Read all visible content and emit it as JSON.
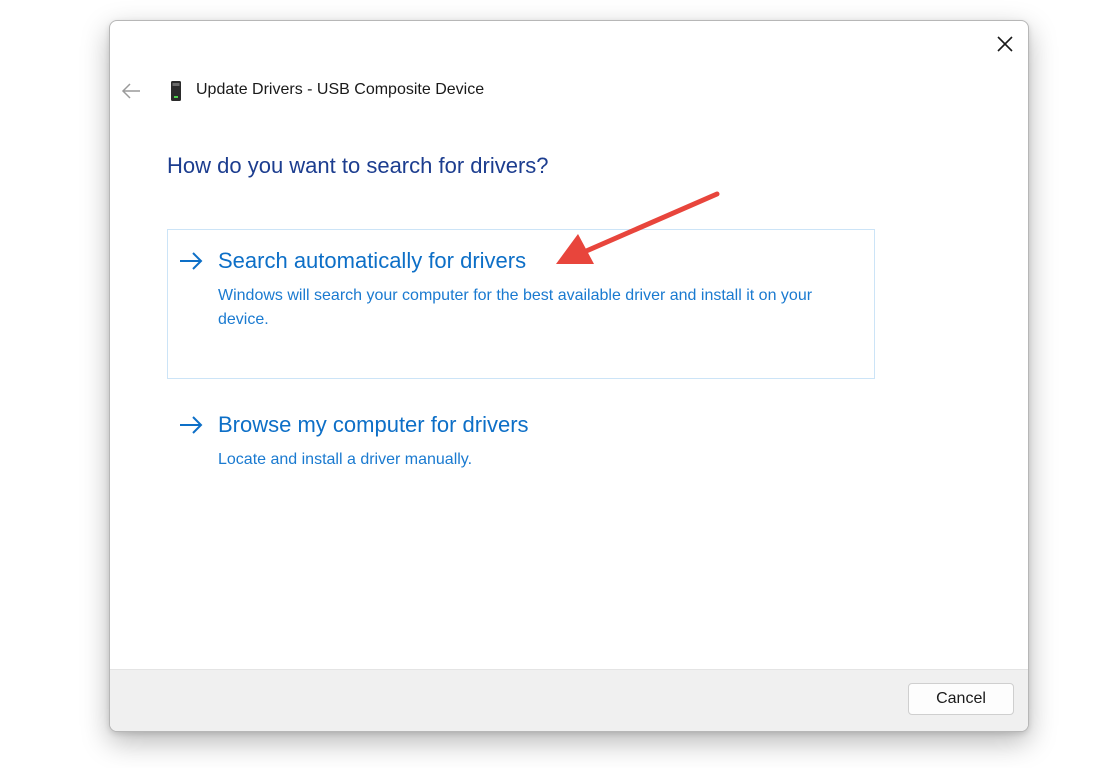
{
  "window": {
    "title": "Update Drivers - USB Composite Device",
    "back_icon": "back-arrow-icon",
    "close_icon": "close-icon",
    "device_icon": "usb-device-icon"
  },
  "main": {
    "heading": "How do you want to search for drivers?",
    "options": [
      {
        "title": "Search automatically for drivers",
        "description": "Windows will search your computer for the best available driver and install it on your device.",
        "icon": "arrow-right-icon",
        "highlighted": true
      },
      {
        "title": "Browse my computer for drivers",
        "description": "Locate and install a driver manually.",
        "icon": "arrow-right-icon",
        "highlighted": false
      }
    ]
  },
  "annotation": {
    "icon": "red-annotation-arrow",
    "color": "#e8453c"
  },
  "footer": {
    "cancel_label": "Cancel"
  },
  "colors": {
    "heading": "#1c3d8f",
    "link": "#0d6fc7",
    "option_border": "#cce4f7",
    "footer_bg": "#f0f0f0"
  }
}
